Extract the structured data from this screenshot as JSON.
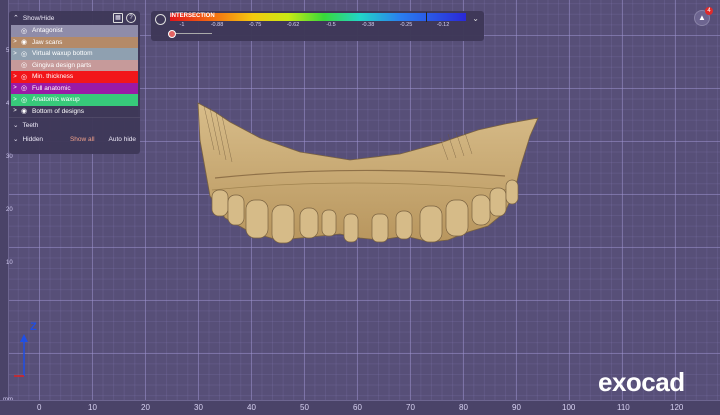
{
  "panel": {
    "title": "Show/Hide",
    "items": [
      {
        "label": "Antagonist",
        "color": "#8f8ca9",
        "arrow": ""
      },
      {
        "label": "Jaw scans",
        "color": "#b48a68",
        "arrow": ">"
      },
      {
        "label": "Virtual waxup bottom",
        "color": "#8fa0b0",
        "arrow": ">"
      },
      {
        "label": "Gingiva design parts",
        "color": "#c69a9a",
        "arrow": ""
      },
      {
        "label": "Min. thickness",
        "color": "#f2161a",
        "arrow": ">"
      },
      {
        "label": "Full anatomic",
        "color": "#9a1aa6",
        "arrow": ">"
      },
      {
        "label": "Anatomic waxup",
        "color": "#37c97a",
        "arrow": ">"
      },
      {
        "label": "Bottom of designs",
        "color": "#3e3858",
        "arrow": ">"
      }
    ],
    "teeth_label": "Teeth",
    "hidden_label": "Hidden",
    "show_all": "Show all",
    "auto_hide": "Auto hide"
  },
  "intersection": {
    "title": "INTERSECTION",
    "ticks": [
      "-1",
      "-0.88",
      "-0.75",
      "-0.62",
      "-0.5",
      "-0.38",
      "-0.25",
      "-0.12"
    ]
  },
  "notifications": {
    "count": "4"
  },
  "ruler_left": [
    "10",
    "20",
    "30",
    "40",
    "50"
  ],
  "ruler_bottom": [
    "0",
    "10",
    "20",
    "30",
    "40",
    "50",
    "60",
    "70",
    "80",
    "90",
    "100",
    "110",
    "120"
  ],
  "unit": "mm",
  "axis_label": "Z",
  "brand": "exocad",
  "colors": {
    "background": "#574f78",
    "accent": "#f0a08a"
  }
}
